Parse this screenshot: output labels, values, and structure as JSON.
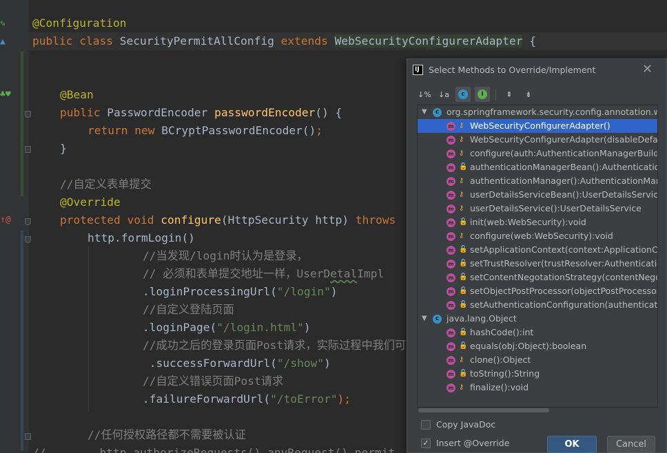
{
  "code": {
    "configuration_annotation": "@Configuration",
    "class_public": "public ",
    "class_kw": "class ",
    "class_name": "SecurityPermitAllConfig ",
    "extends_kw": "extends ",
    "base_class": "WebSecurityConfigurerAdapter",
    "class_brace": " {",
    "bean_annotation": "@Bean",
    "bean_public": "public ",
    "bean_type": "PasswordEncoder ",
    "bean_method": "passwordEncoder",
    "bean_params": "() {",
    "return_kw": "return ",
    "new_kw": "new ",
    "encoder_call": "BCryptPasswordEncoder()",
    "semicolon": ";",
    "close_brace": "}",
    "comment_custom_form": "//自定义表单提交",
    "override_annotation": "@Override",
    "protected_kw": "protected ",
    "void_kw": "void ",
    "configure_name": "configure",
    "configure_params": "(HttpSecurity http) ",
    "throws_kw": "throws",
    "form_login": "http.formLogin()",
    "comment_login_1": "//当发现/login时认为是登录，",
    "comment_login_2a": "// 必须和表单提交地址一样，UserD",
    "comment_login_2b": "etal",
    "comment_login_2c": "Impl",
    "login_processing_a": ".loginProcessingUrl(",
    "login_processing_str": "\"/login\"",
    "call_close": ")",
    "comment_login_page": "//自定义登陆页面",
    "login_page_a": ".loginPage(",
    "login_page_str": "\"/login.html\"",
    "comment_success": "//成功之后的登录页面Post请求，实际过程中我们可以",
    "success_a": " .successForwardUrl(",
    "success_str": "\"/show\"",
    "comment_error": "//自定义错误页面Post请求",
    "failure_a": ".failureForwardUrl(",
    "failure_str": "\"/toError\"",
    "failure_end": ");",
    "comment_auth": "//任何授权路径都不需要被认证",
    "commented_slashes": "//",
    "commented_auth": "        http.authorizeRequests().anyRequest().permit"
  },
  "dialog": {
    "title": "Select Methods to Override/Implement",
    "close_glyph": "✕",
    "app_icon_text": "IJ",
    "toolbar": {
      "sort_visibility": "↓%",
      "sort_alpha": "↓a",
      "class_icon": "c",
      "interface_icon": "I",
      "expand_all": "⇞",
      "collapse_all": "⇟"
    },
    "groups": [
      {
        "name": "org.springframework.security.config.annotation.web.",
        "methods": [
          "WebSecurityConfigurerAdapter()",
          "WebSecurityConfigurerAdapter(disableDefaults",
          "configure(auth:AuthenticationManagerBuilder):",
          "authenticationManagerBean():AuthenticationMa",
          "authenticationManager():AuthenticationManage",
          "userDetailsServiceBean():UserDetailsService",
          "userDetailsService():UserDetailsService",
          "init(web:WebSecurity):void",
          "configure(web:WebSecurity):void",
          "setApplicationContext(context:ApplicationConte",
          "setTrustResolver(trustResolver:AuthenticationTr",
          "setContentNegotationStrategy(contentNegotiat",
          "setObjectPostProcessor(objectPostProcessor:O",
          "setAuthenticationConfiguration(authenticationC"
        ]
      },
      {
        "name": "java.lang.Object",
        "methods": [
          "hashCode():int",
          "equals(obj:Object):boolean",
          "clone():Object",
          "toString():String",
          "finalize():void"
        ]
      }
    ],
    "copy_javadoc_label": "Copy JavaDoc",
    "insert_override_label": "Insert @Override",
    "checked_glyph": "✓",
    "ok_label": "OK",
    "cancel_label": "Cancel"
  }
}
